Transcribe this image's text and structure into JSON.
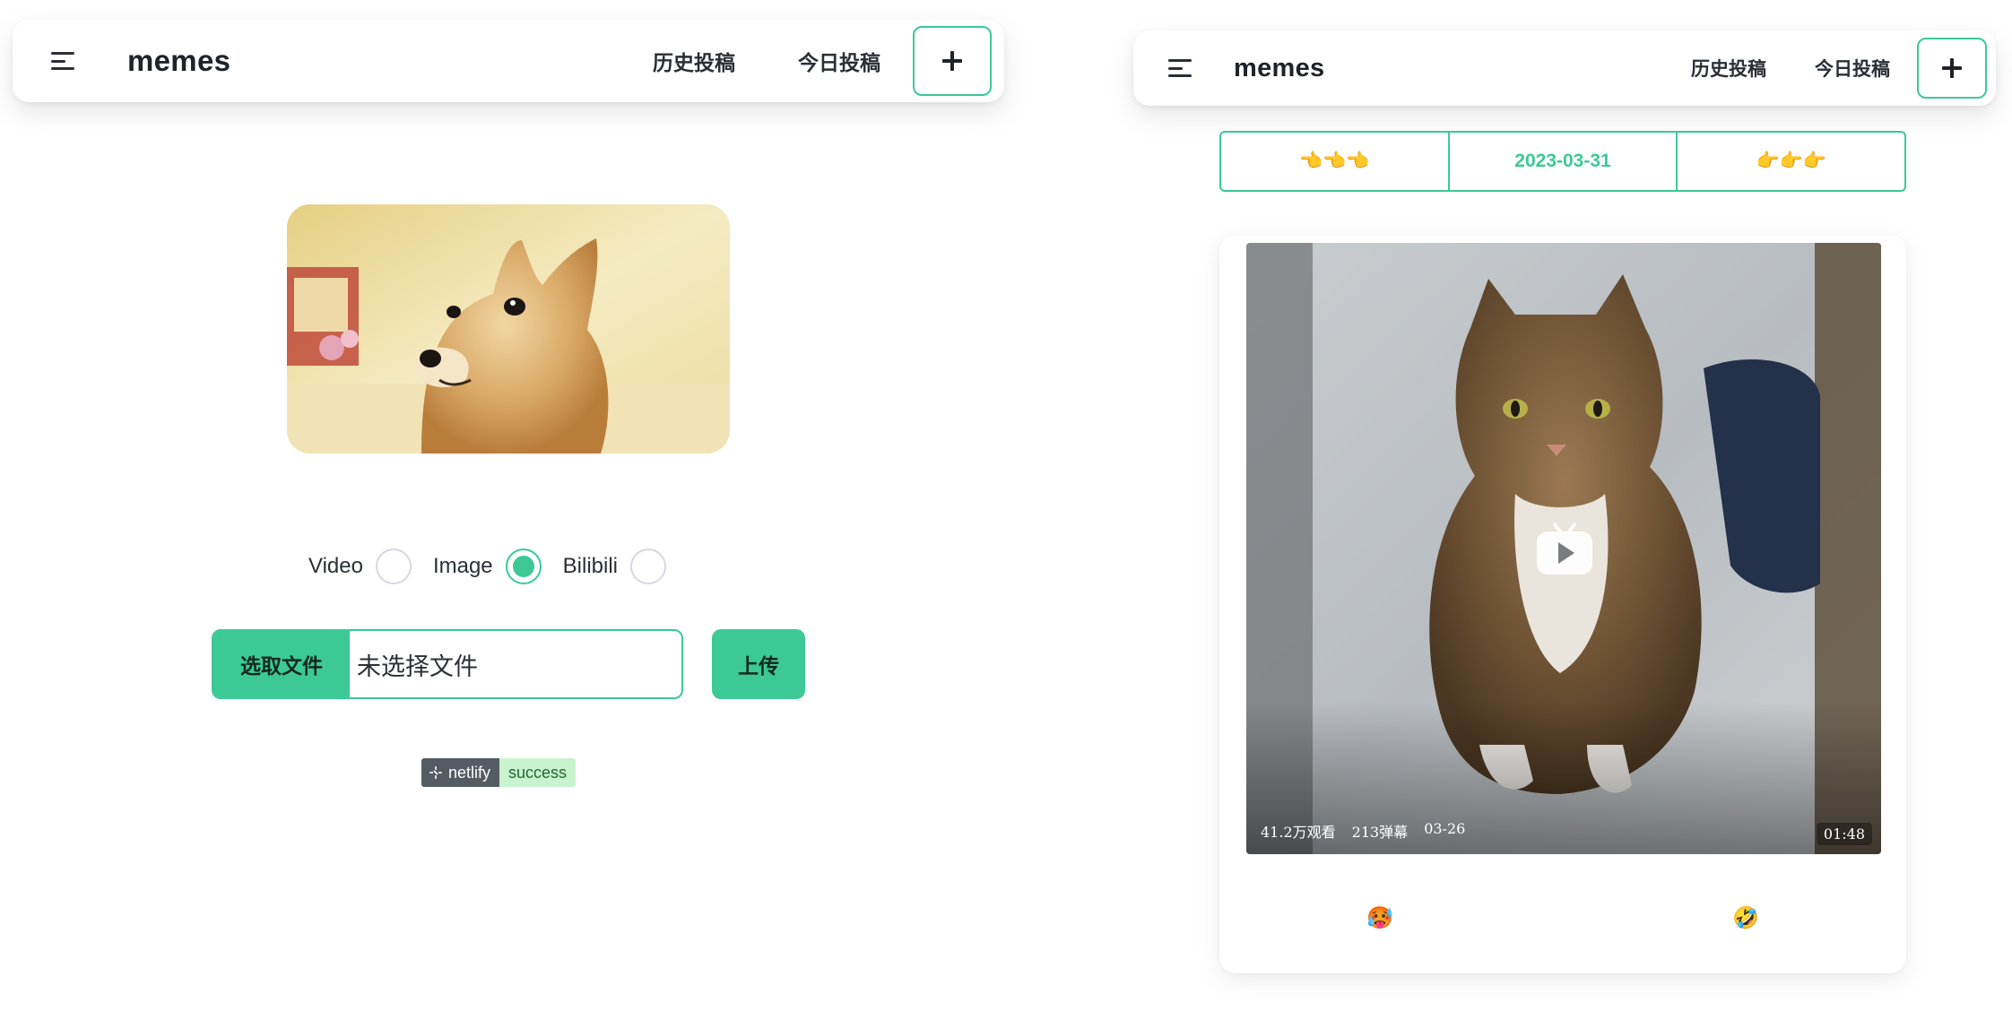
{
  "left": {
    "navbar": {
      "brand": "memes",
      "history_label": "历史投稿",
      "today_label": "今日投稿",
      "icons": {
        "menu": "menu-icon",
        "add": "plus-icon"
      }
    },
    "radios": [
      {
        "label": "Video",
        "checked": false
      },
      {
        "label": "Image",
        "checked": true
      },
      {
        "label": "Bilibili",
        "checked": false
      }
    ],
    "file_input": {
      "choose_label": "选取文件",
      "status": "未选择文件"
    },
    "upload_label": "上传",
    "badge": {
      "left": "netlify",
      "right": "success"
    }
  },
  "right": {
    "navbar": {
      "brand": "memes",
      "history_label": "历史投稿",
      "today_label": "今日投稿"
    },
    "date_nav": {
      "prev": "👈👈👈",
      "date": "2023-03-31",
      "next": "👉👉👉"
    },
    "video": {
      "views": "41.2万观看",
      "danmaku": "213弹幕",
      "date": "03-26",
      "duration": "01:48"
    },
    "reactions": {
      "left": "🥵",
      "right": "🤣"
    }
  },
  "colors": {
    "accent": "#3cc996",
    "text": "#1f2328"
  }
}
